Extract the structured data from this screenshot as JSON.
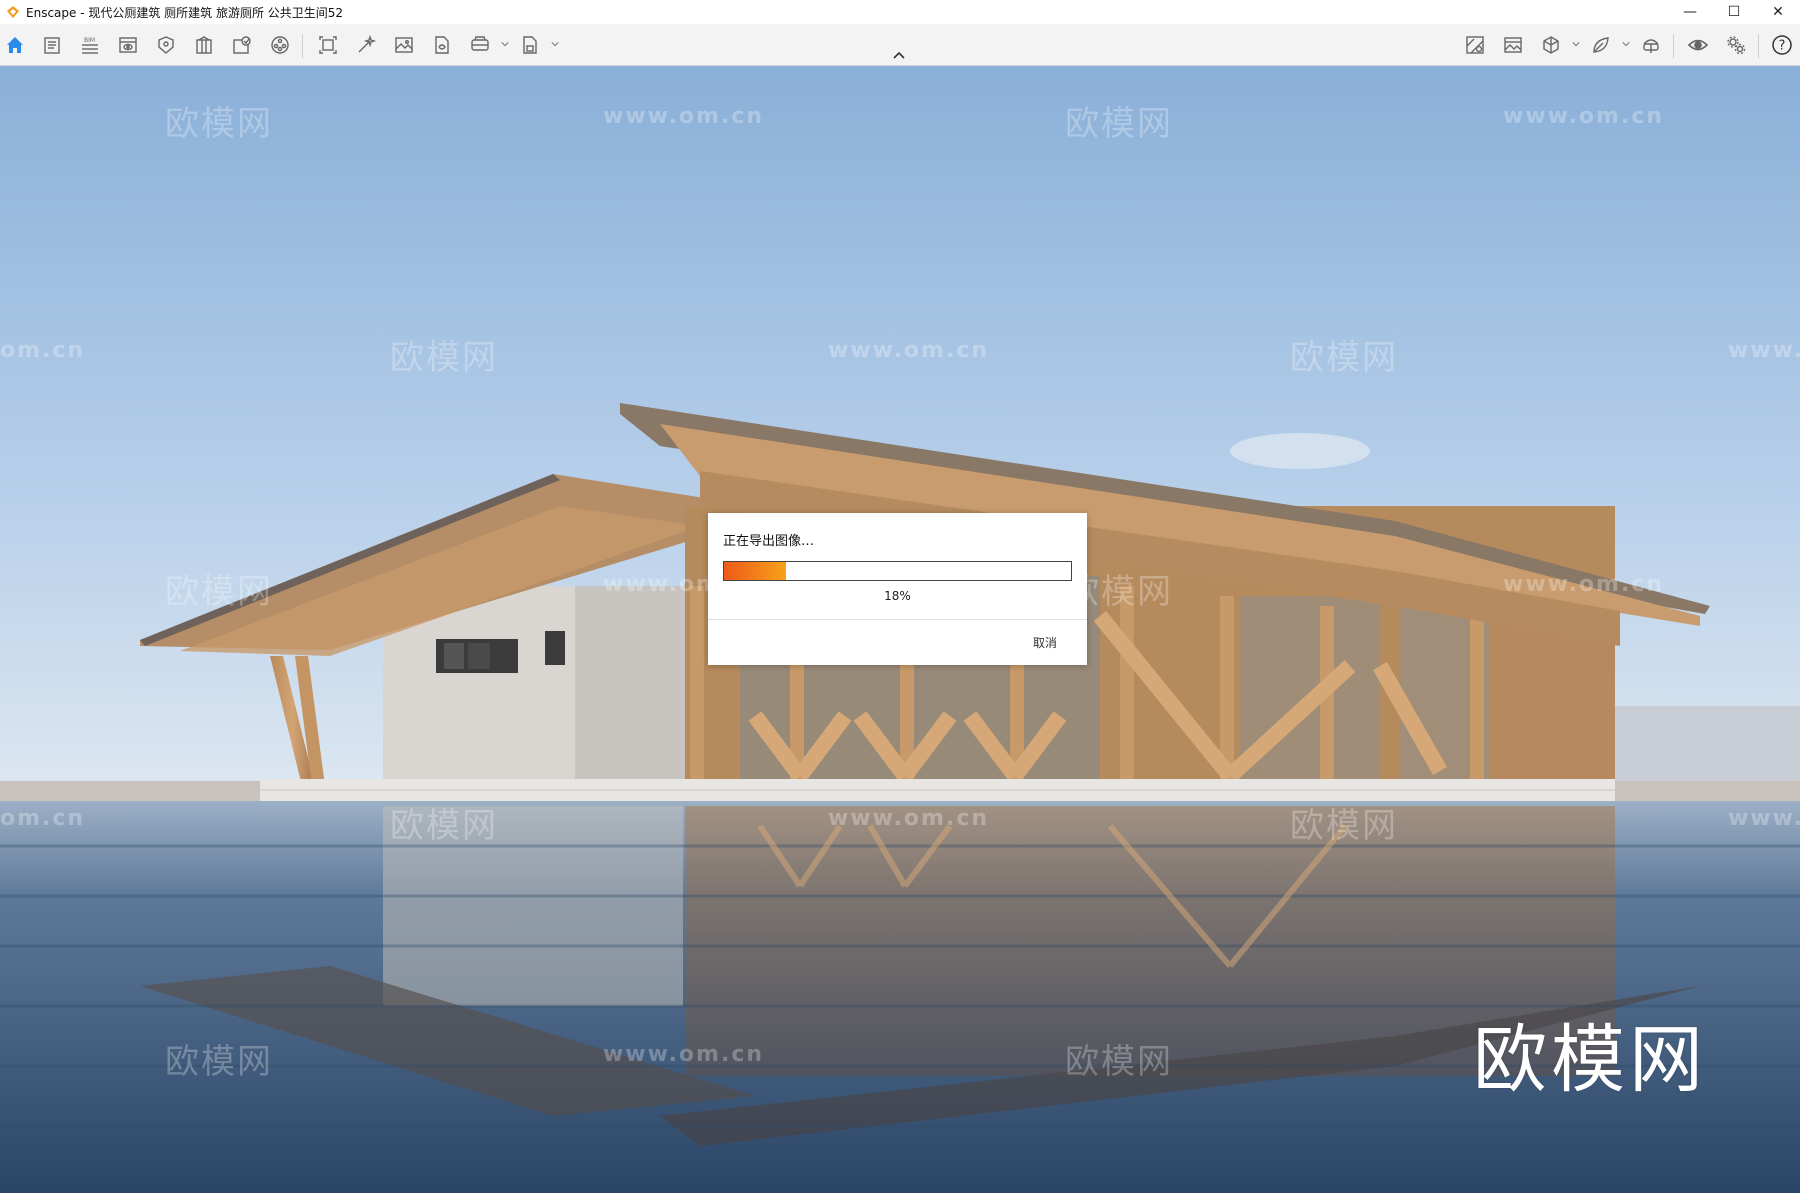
{
  "window": {
    "title": "Enscape - 现代公厕建筑 厕所建筑 旅游厕所 公共卫生间52",
    "controls": [
      "—",
      "☐",
      "✕"
    ]
  },
  "toolbar": {
    "left_icons": [
      "home-icon",
      "notes-icon",
      "bim-icon",
      "view-management-icon",
      "asset-library-icon",
      "material-editor-icon",
      "batch-render-icon",
      "site-context-icon",
      "render-icon",
      "annotate-icon",
      "screenshot-icon",
      "upload-icon",
      "panorama-icon",
      "export-icon"
    ],
    "right_icons": [
      "map-icon",
      "atmosphere-icon",
      "cube-icon",
      "leaf-icon",
      "vr-headset-icon",
      "visibility-icon",
      "settings-icon",
      "help-icon"
    ],
    "bim_label": "BIM",
    "help_glyph": "?"
  },
  "watermarks": {
    "brand": "欧模网",
    "url": "www.om.cn",
    "url_partial": "om.cn",
    "big_logo": "欧模网"
  },
  "dialog": {
    "title": "正在导出图像…",
    "progress": 0.18,
    "progress_label": "18%",
    "cancel_label": "取消",
    "colors": {
      "fill_start": "#ee5a1a",
      "fill_end": "#f7a11a"
    }
  },
  "colors": {
    "accent": "#2a8be8",
    "sky_top": "#8fb2d9",
    "water": "#3a5576"
  }
}
